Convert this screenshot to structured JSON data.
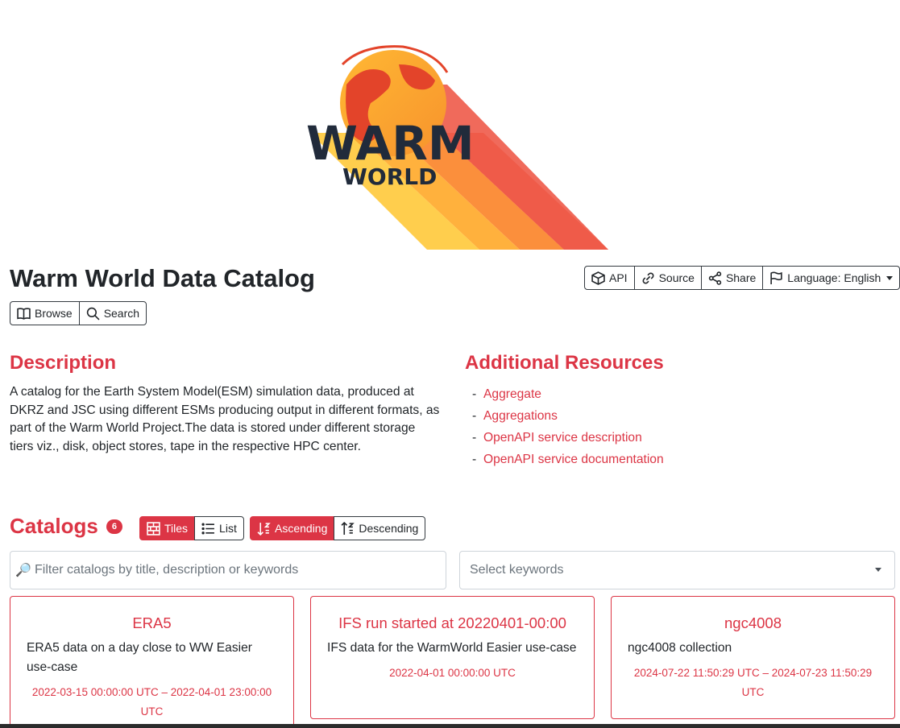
{
  "logo": {
    "text_main": "WARM",
    "text_sub": "WORLD"
  },
  "page_title": "Warm World Data Catalog",
  "top_actions": {
    "api": "API",
    "source": "Source",
    "share": "Share",
    "language": "Language: English"
  },
  "nav_actions": {
    "browse": "Browse",
    "search": "Search"
  },
  "description": {
    "title": "Description",
    "text": "A catalog for the Earth System Model(ESM) simulation data, produced at DKRZ and JSC using different ESMs producing output in different formats, as part of the Warm World Project.The data is stored under different storage tiers viz., disk, object stores, tape in the respective HPC center."
  },
  "resources": {
    "title": "Additional Resources",
    "links": [
      {
        "label": "Aggregate"
      },
      {
        "label": "Aggregations"
      },
      {
        "label": "OpenAPI service description"
      },
      {
        "label": "OpenAPI service documentation"
      }
    ]
  },
  "catalogs": {
    "title": "Catalogs",
    "count": "6",
    "view": {
      "tiles": "Tiles",
      "list": "List",
      "active": "tiles"
    },
    "sort": {
      "asc": "Ascending",
      "desc": "Descending",
      "active": "asc"
    },
    "filter_placeholder": "Filter catalogs by title, description or keywords",
    "keywords_placeholder": "Select keywords",
    "items": [
      {
        "title": "ERA5",
        "description": "ERA5 data on a day close to WW Easier use-case",
        "dates": "2022-03-15 00:00:00 UTC – 2022-04-01 23:00:00 UTC"
      },
      {
        "title": "IFS run started at 20220401-00:00",
        "description": "IFS data for the WarmWorld Easier use-case",
        "dates": "2022-04-01 00:00:00 UTC"
      },
      {
        "title": "ngc4008",
        "description": "ngc4008 collection",
        "dates": "2024-07-22 11:50:29 UTC – 2024-07-23 11:50:29 UTC"
      }
    ]
  },
  "colors": {
    "accent": "#dc3545",
    "text": "#212529",
    "border": "#343a40"
  }
}
